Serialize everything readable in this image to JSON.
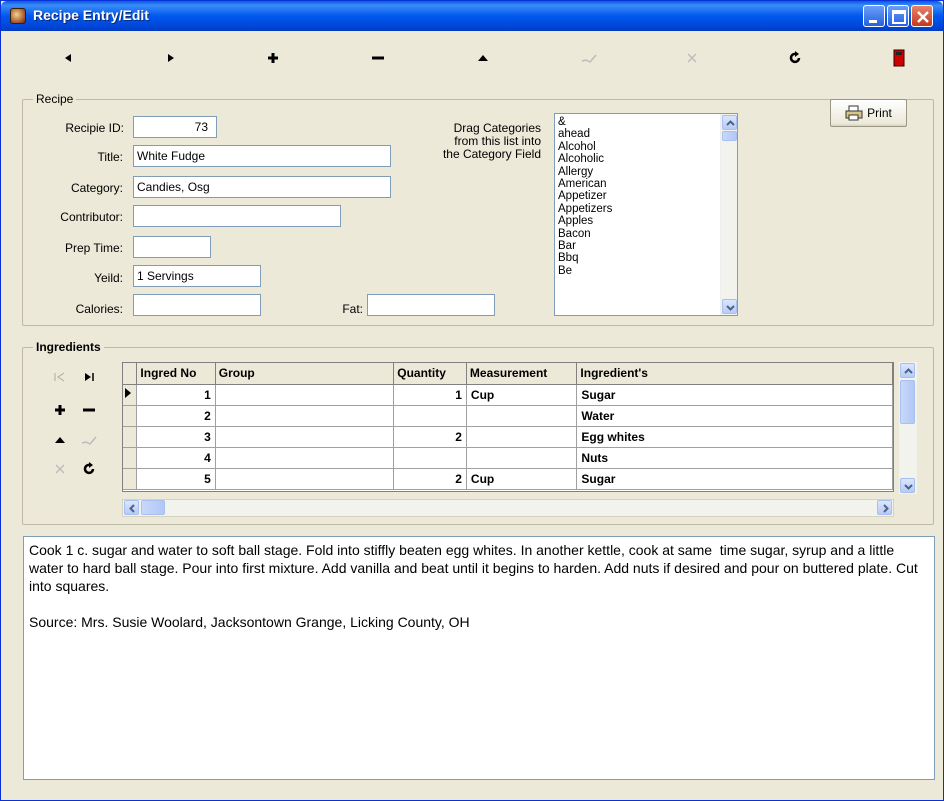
{
  "window": {
    "title": "Recipe Entry/Edit"
  },
  "nav": {
    "prev_icon": "triangle-left-icon",
    "next_icon": "triangle-right-icon",
    "add_icon": "plus-icon",
    "delete_icon": "minus-icon",
    "edit_icon": "triangle-up-icon",
    "post_icon": "check-icon",
    "cancel_icon": "x-icon",
    "refresh_icon": "refresh-icon",
    "exit_icon": "door-icon"
  },
  "recipe": {
    "group_label": "Recipe",
    "id_label": "Recipie ID:",
    "id_value": "73",
    "title_label": "Title:",
    "title_value": "White Fudge",
    "category_label": "Category:",
    "category_value": "Candies, Osg",
    "contributor_label": "Contributor:",
    "contributor_value": "",
    "prep_label": "Prep Time:",
    "prep_value": "",
    "yield_label": "Yeild:",
    "yield_value": "1 Servings",
    "calories_label": "Calories:",
    "calories_value": "",
    "fat_label": "Fat:",
    "fat_value": "",
    "drag_hint": "Drag Categories\nfrom this list into\nthe Category Field",
    "print_label": "Print",
    "categories": [
      "&",
      "ahead",
      "Alcohol",
      "Alcoholic",
      "Allergy",
      "American",
      "Appetizer",
      "Appetizers",
      "Apples",
      "Bacon",
      "Bar",
      "Bbq",
      "Be"
    ]
  },
  "ingredients": {
    "group_label": "Ingredients",
    "columns": [
      "Ingred No",
      "Group",
      "Quantity",
      "Measurement",
      "Ingredient's"
    ],
    "rows": [
      {
        "no": "1",
        "group": "",
        "qty": "1",
        "measure": "Cup",
        "ingredient": "Sugar"
      },
      {
        "no": "2",
        "group": "",
        "qty": "",
        "measure": "",
        "ingredient": "Water"
      },
      {
        "no": "3",
        "group": "",
        "qty": "2",
        "measure": "",
        "ingredient": "Egg whites"
      },
      {
        "no": "4",
        "group": "",
        "qty": "",
        "measure": "",
        "ingredient": "Nuts"
      },
      {
        "no": "5",
        "group": "",
        "qty": "2",
        "measure": "Cup",
        "ingredient": "Sugar"
      }
    ]
  },
  "notes": {
    "text": "Cook 1 c. sugar and water to soft ball stage. Fold into stiffly beaten egg whites. In another kettle, cook at same  time sugar, syrup and a little water to hard ball stage. Pour into first mixture. Add vanilla and beat until it begins to harden. Add nuts if desired and pour on buttered plate. Cut into squares.\n\nSource: Mrs. Susie Woolard, Jacksontown Grange, Licking County, OH"
  }
}
